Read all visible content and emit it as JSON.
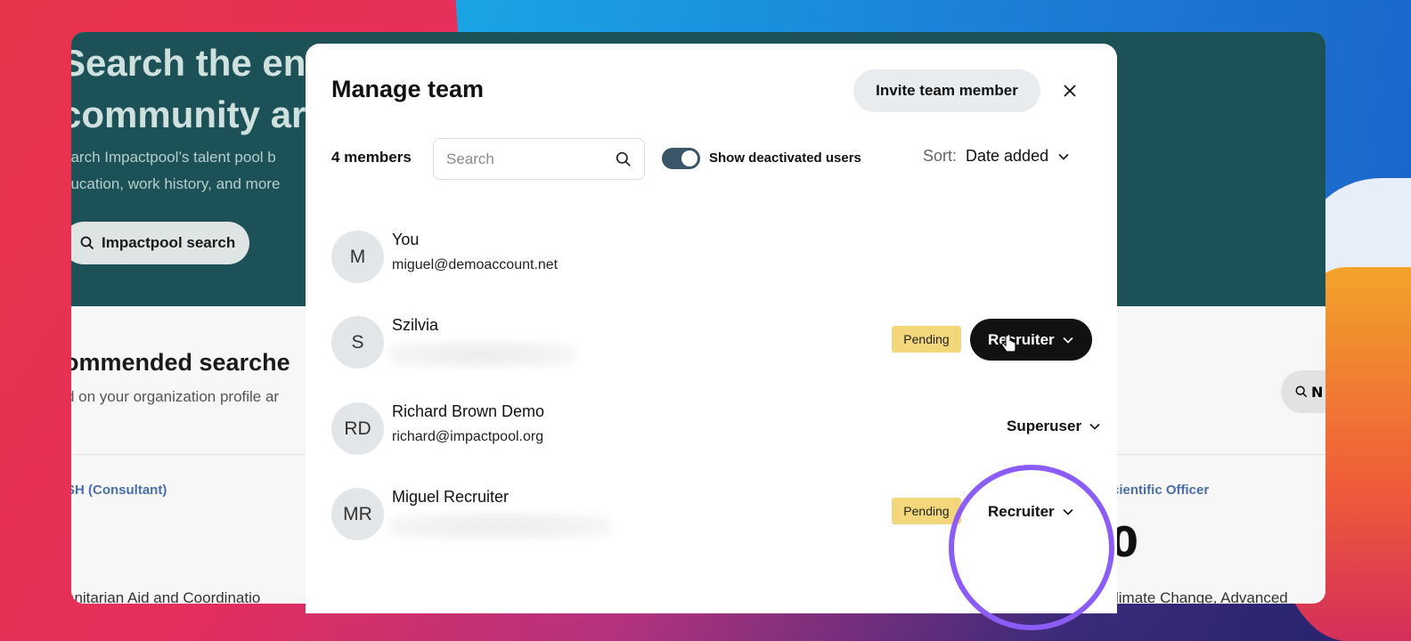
{
  "background_app": {
    "hero_title_line1": "Search the en",
    "hero_title_line2": "community ar",
    "hero_sub_line1": "earch Impactpool’s talent pool b",
    "hero_sub_line2": "ducation, work history, and more",
    "hero_button_label": "Impactpool search",
    "recommended_title": "ommended searche",
    "recommended_sub": "d on your organization profile ar",
    "right_pill_label": "N",
    "card_tag_left": "SH (Consultant)",
    "card_tag_right": "cientific Officer",
    "card_foot_left": "anitarian Aid and Coordinatio",
    "card_foot_right": "limate Change, Advanced",
    "big_number": "0"
  },
  "modal": {
    "title": "Manage team",
    "invite_button": "Invite team member",
    "close_icon": "close-icon",
    "members_count": "4 members",
    "search": {
      "placeholder": "Search",
      "value": ""
    },
    "show_deactivated": {
      "label": "Show deactivated users",
      "on": true
    },
    "sort": {
      "label": "Sort:",
      "value": "Date added"
    },
    "members": [
      {
        "initials": "M",
        "name": "You",
        "email": "miguel@demoaccount.net",
        "email_hidden": false,
        "pending": false,
        "role": ""
      },
      {
        "initials": "S",
        "name": "Szilvia",
        "email": "",
        "email_hidden": true,
        "pending": true,
        "pending_label": "Pending",
        "role": "Recruiter",
        "role_active": true
      },
      {
        "initials": "RD",
        "name": "Richard Brown Demo",
        "email": "richard@impactpool.org",
        "email_hidden": false,
        "pending": false,
        "role": "Superuser"
      },
      {
        "initials": "MR",
        "name": "Miguel Recruiter",
        "email": "",
        "email_hidden": true,
        "pending": true,
        "pending_label": "Pending",
        "role": "Recruiter"
      }
    ]
  },
  "colors": {
    "hero_bg": "#1b5157",
    "toggle_on": "#3b5568",
    "pending_bg": "#f4d77a",
    "highlight_ring": "#8b5cf6",
    "active_role_bg": "#111111"
  }
}
